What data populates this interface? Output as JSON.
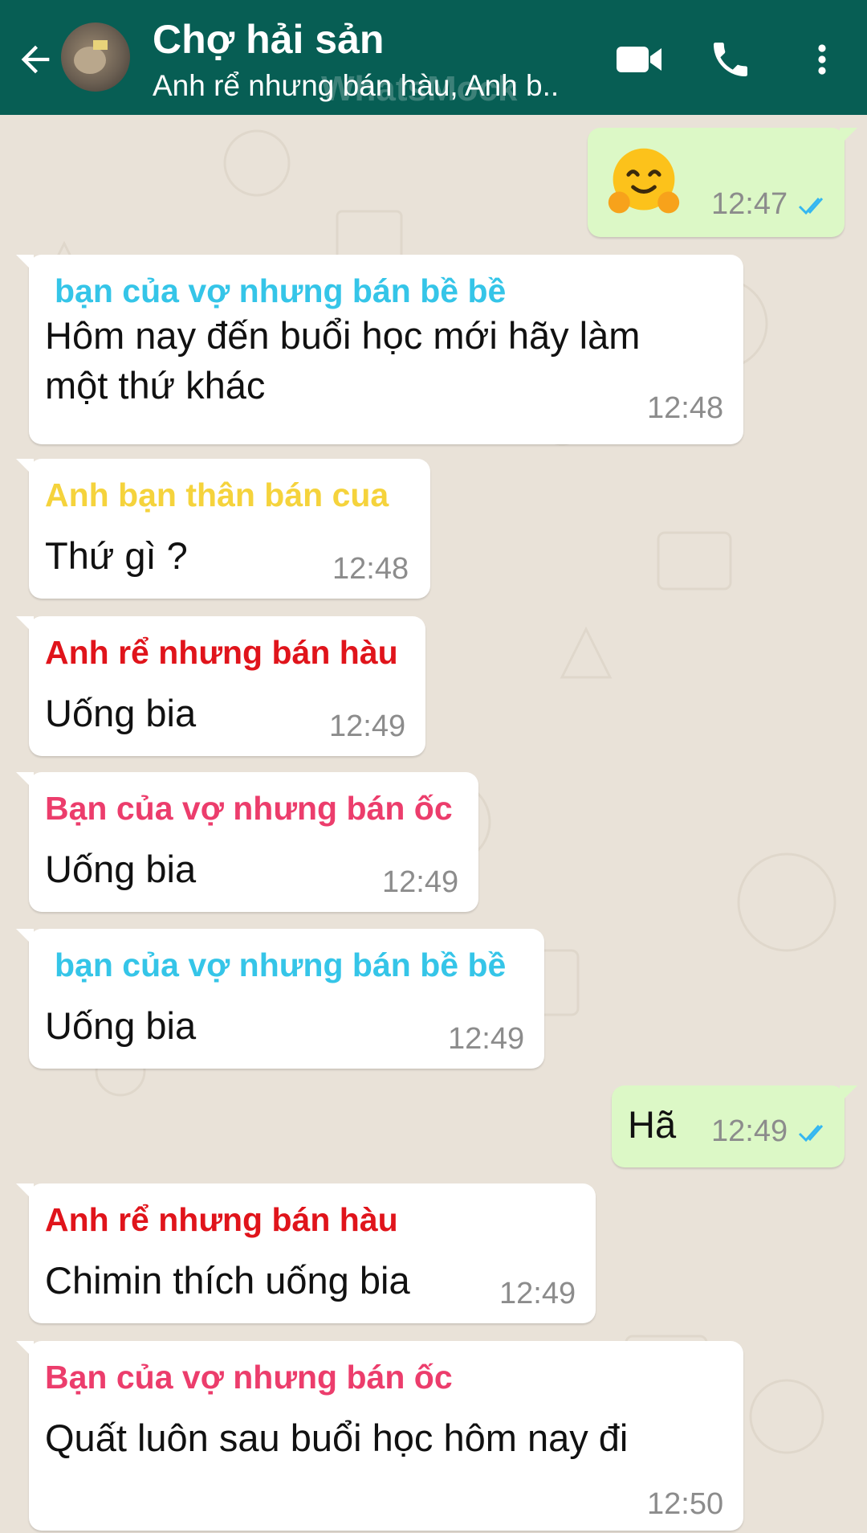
{
  "header": {
    "title": "Chợ hải sản",
    "subtitle": "Anh rể nhưng bán hàu, Anh b..",
    "watermark": "WhatsMock",
    "color": "#075e54"
  },
  "icons": {
    "back": "arrow-left-icon",
    "video": "video-call-icon",
    "phone": "phone-icon",
    "menu": "more-vert-icon"
  },
  "messages": [
    {
      "type": "outgoing",
      "emoji": "hugging-face",
      "time": "12:47",
      "status": "read"
    },
    {
      "type": "incoming",
      "sender": "bạn của vợ nhưng bán bề bề",
      "sender_color": "#35c5e8",
      "text_lines": [
        "Hôm nay đến buổi học mới hãy làm",
        "một thứ khác"
      ],
      "time": "12:48"
    },
    {
      "type": "incoming",
      "sender": "Anh bạn thân bán cua",
      "sender_color": "#f5d33c",
      "text": "Thứ gì ?",
      "time": "12:48"
    },
    {
      "type": "incoming",
      "sender": "Anh rể nhưng bán hàu",
      "sender_color": "#e0141b",
      "text": "Uống bia",
      "time": "12:49"
    },
    {
      "type": "incoming",
      "sender": "Bạn của vợ nhưng bán ốc",
      "sender_color": "#ec3d6c",
      "text": "Uống bia",
      "time": "12:49"
    },
    {
      "type": "incoming",
      "sender": "bạn của vợ nhưng bán bề bề",
      "sender_color": "#35c5e8",
      "text": "Uống bia",
      "time": "12:49"
    },
    {
      "type": "outgoing",
      "text": "Hã",
      "time": "12:49",
      "status": "read"
    },
    {
      "type": "incoming",
      "sender": "Anh rể nhưng bán hàu",
      "sender_color": "#e0141b",
      "text": "Chimin thích uống bia",
      "time": "12:49"
    },
    {
      "type": "incoming",
      "sender": "Bạn của vợ nhưng bán ốc",
      "sender_color": "#ec3d6c",
      "text": "Quất luôn sau buổi học hôm nay đi",
      "time": "12:50"
    }
  ],
  "colors": {
    "outgoing_bubble": "#dcf8c6",
    "incoming_bubble": "#ffffff",
    "read_ticks": "#34b7f1",
    "chat_bg": "#e9e2d8"
  }
}
